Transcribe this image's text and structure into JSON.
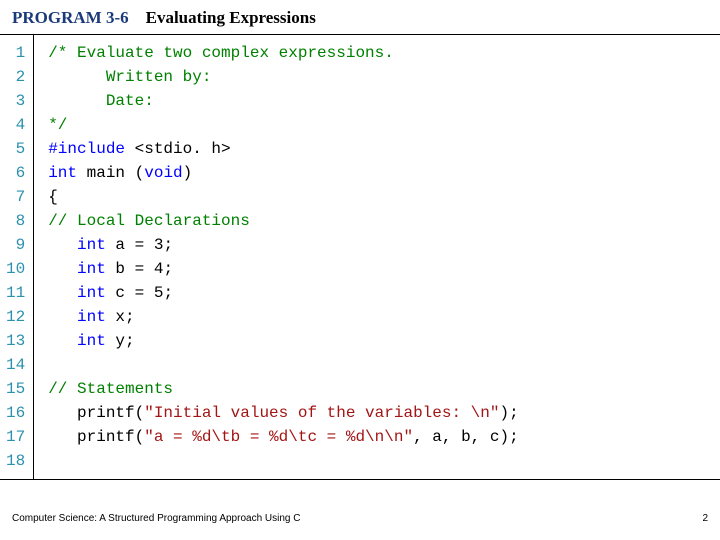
{
  "header": {
    "program_label": "PROGRAM 3-6",
    "title": "Evaluating Expressions"
  },
  "code": {
    "lines": [
      {
        "num": "1",
        "t": [
          {
            "c": "c-comment",
            "s": "/* Evaluate two complex expressions."
          }
        ]
      },
      {
        "num": "2",
        "t": [
          {
            "c": "c-comment",
            "s": "      Written by:"
          }
        ]
      },
      {
        "num": "3",
        "t": [
          {
            "c": "c-comment",
            "s": "      Date:"
          }
        ]
      },
      {
        "num": "4",
        "t": [
          {
            "c": "c-comment",
            "s": "*/"
          }
        ]
      },
      {
        "num": "5",
        "t": [
          {
            "c": "c-keyword",
            "s": "#include"
          },
          {
            "c": "c-plain",
            "s": " <stdio. h>"
          }
        ]
      },
      {
        "num": "6",
        "t": [
          {
            "c": "c-keyword",
            "s": "int"
          },
          {
            "c": "c-plain",
            "s": " main ("
          },
          {
            "c": "c-keyword",
            "s": "void"
          },
          {
            "c": "c-plain",
            "s": ")"
          }
        ]
      },
      {
        "num": "7",
        "t": [
          {
            "c": "c-plain",
            "s": "{"
          }
        ]
      },
      {
        "num": "8",
        "t": [
          {
            "c": "c-comment",
            "s": "// Local Declarations"
          }
        ]
      },
      {
        "num": "9",
        "t": [
          {
            "c": "c-plain",
            "s": "   "
          },
          {
            "c": "c-keyword",
            "s": "int"
          },
          {
            "c": "c-plain",
            "s": " a = 3;"
          }
        ]
      },
      {
        "num": "10",
        "t": [
          {
            "c": "c-plain",
            "s": "   "
          },
          {
            "c": "c-keyword",
            "s": "int"
          },
          {
            "c": "c-plain",
            "s": " b = 4;"
          }
        ]
      },
      {
        "num": "11",
        "t": [
          {
            "c": "c-plain",
            "s": "   "
          },
          {
            "c": "c-keyword",
            "s": "int"
          },
          {
            "c": "c-plain",
            "s": " c = 5;"
          }
        ]
      },
      {
        "num": "12",
        "t": [
          {
            "c": "c-plain",
            "s": "   "
          },
          {
            "c": "c-keyword",
            "s": "int"
          },
          {
            "c": "c-plain",
            "s": " x;"
          }
        ]
      },
      {
        "num": "13",
        "t": [
          {
            "c": "c-plain",
            "s": "   "
          },
          {
            "c": "c-keyword",
            "s": "int"
          },
          {
            "c": "c-plain",
            "s": " y;"
          }
        ]
      },
      {
        "num": "14",
        "t": [
          {
            "c": "c-plain",
            "s": " "
          }
        ]
      },
      {
        "num": "15",
        "t": [
          {
            "c": "c-comment",
            "s": "// Statements"
          }
        ]
      },
      {
        "num": "16",
        "t": [
          {
            "c": "c-plain",
            "s": "   printf("
          },
          {
            "c": "c-string",
            "s": "\"Initial values of the variables: \\n\""
          },
          {
            "c": "c-plain",
            "s": ");"
          }
        ]
      },
      {
        "num": "17",
        "t": [
          {
            "c": "c-plain",
            "s": "   printf("
          },
          {
            "c": "c-string",
            "s": "\"a = %d\\tb = %d\\tc = %d\\n\\n\""
          },
          {
            "c": "c-plain",
            "s": ", a, b, c);"
          }
        ]
      },
      {
        "num": "18",
        "t": [
          {
            "c": "c-plain",
            "s": " "
          }
        ]
      }
    ]
  },
  "footer": {
    "left": "Computer Science: A Structured Programming Approach Using C",
    "right": "2"
  }
}
